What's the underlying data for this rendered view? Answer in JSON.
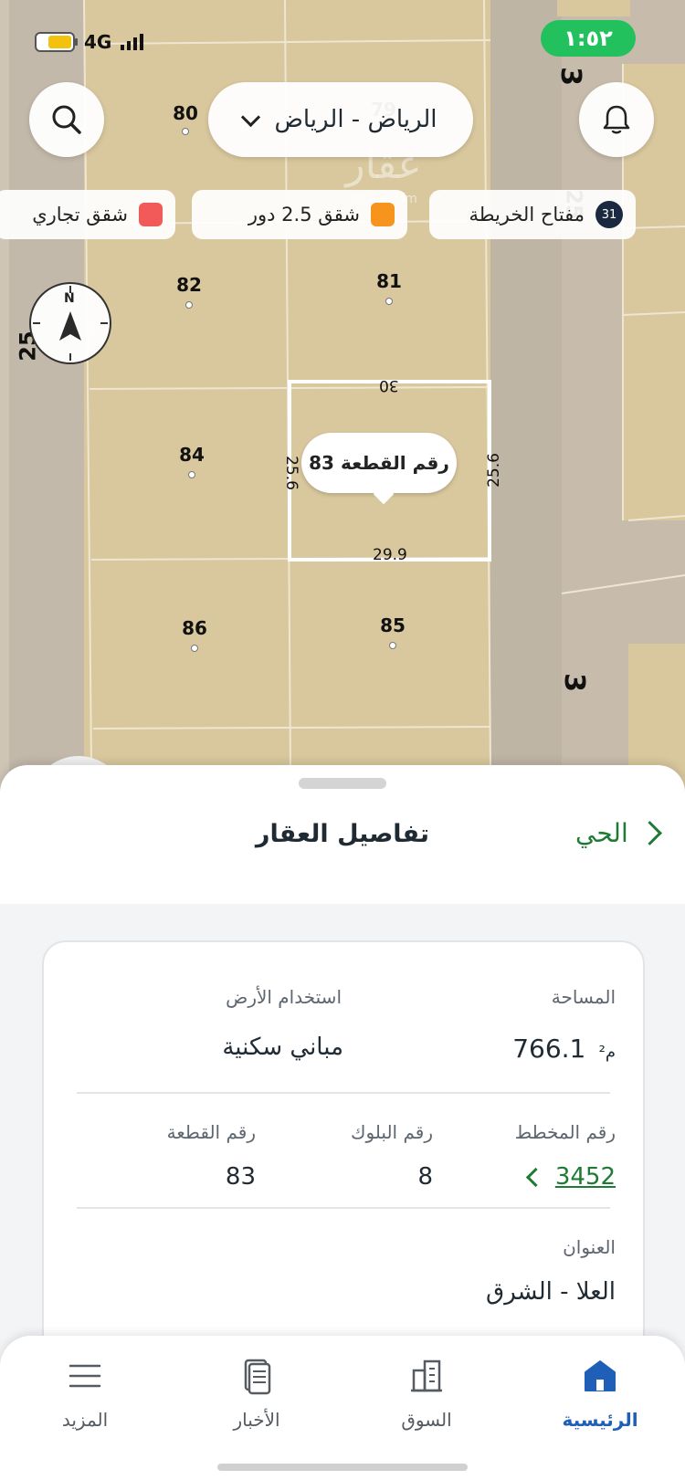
{
  "status_bar": {
    "network": "4G",
    "time": "١:٥٢",
    "battery_fraction": 0.7
  },
  "header": {
    "city_selector": "الرياض - الرياض",
    "search_icon": "search-icon",
    "notifications_icon": "bell-icon"
  },
  "legend": [
    {
      "badge": "31",
      "label": "مفتاح الخريطة"
    },
    {
      "label": "شقق 2.5 دور",
      "color": "#f7941d"
    },
    {
      "label": "شقق تجاري",
      "color": "#f25a5a"
    }
  ],
  "map": {
    "compass_label": "N",
    "plots": [
      "79",
      "80",
      "81",
      "82",
      "84",
      "85",
      "86"
    ],
    "streets": [
      "25",
      "25",
      "3",
      "3"
    ],
    "selected_plot": {
      "label": "رقم القطعة 83",
      "dim_top": "30",
      "dim_left": "25.6",
      "dim_right": "25.6",
      "dim_bottom": "29.9"
    },
    "watermark": "عقار",
    "watermark_url": "sa.aqar.fm",
    "plot_fill": "#d9c89e",
    "selected_outline": "#ffffff"
  },
  "sheet": {
    "title": "تفاصيل العقار",
    "back_label": "الحي",
    "area_label": "المساحة",
    "area_value": "766.1",
    "area_unit": "م²",
    "land_use_label": "استخدام الأرض",
    "land_use_value": "مباني سكنية",
    "plan_label": "رقم المخطط",
    "plan_value": "3452",
    "block_label": "رقم البلوك",
    "block_value": "8",
    "plot_label": "رقم القطعة",
    "plot_value": "83",
    "address_label": "العنوان",
    "address_value": "العلا - الشرق"
  },
  "bottom_nav": [
    {
      "label": "الرئيسية",
      "icon": "home-icon",
      "active": true
    },
    {
      "label": "السوق",
      "icon": "building-icon",
      "active": false
    },
    {
      "label": "الأخبار",
      "icon": "news-icon",
      "active": false
    },
    {
      "label": "المزيد",
      "icon": "menu-icon",
      "active": false
    }
  ],
  "colors": {
    "accent_green": "#1e7a34",
    "active_blue": "#1f5fb8",
    "time_green": "#23c15e"
  }
}
